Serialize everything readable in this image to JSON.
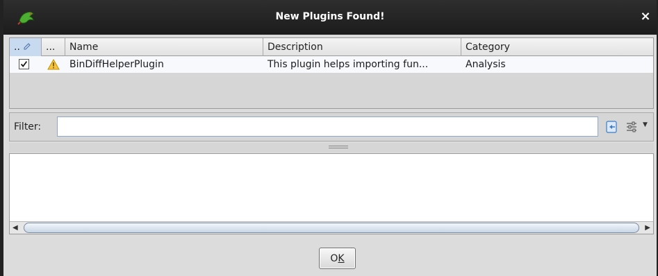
{
  "window": {
    "title": "New Plugins Found!",
    "close_glyph": "×",
    "app_icon": "dragon-icon"
  },
  "table": {
    "headers": {
      "check": "..",
      "status": "...",
      "name": "Name",
      "description": "Description",
      "category": "Category"
    },
    "rows": [
      {
        "checked": true,
        "status_icon": "warning-icon",
        "name": "BinDiffHelperPlugin",
        "description": "This plugin helps importing fun...",
        "category": "Analysis"
      }
    ]
  },
  "filter": {
    "label": "Filter:",
    "value": ""
  },
  "buttons": {
    "ok_first": "O",
    "ok_mnemonic": "K"
  }
}
